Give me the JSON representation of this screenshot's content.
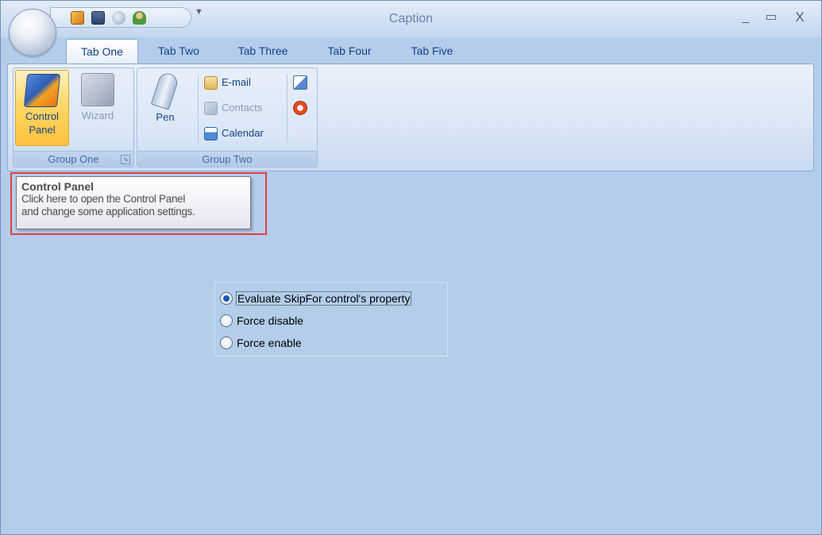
{
  "window": {
    "caption": "Caption"
  },
  "title_buttons": {
    "minimize": "_",
    "maximize": "▭",
    "close": "X"
  },
  "quick_access": {
    "icons": [
      "control-panel-icon",
      "save-icon",
      "search-icon",
      "user-icon"
    ],
    "dropdown": "▼"
  },
  "tabs": [
    {
      "label": "Tab One",
      "active": true
    },
    {
      "label": "Tab Two",
      "active": false
    },
    {
      "label": "Tab Three",
      "active": false
    },
    {
      "label": "Tab Four",
      "active": false
    },
    {
      "label": "Tab Five",
      "active": false
    }
  ],
  "ribbon": {
    "group_one": {
      "title": "Group One",
      "launcher": "↘",
      "control_panel": {
        "line1": "Control",
        "line2": "Panel"
      },
      "wizard": {
        "label": "Wizard"
      }
    },
    "group_two": {
      "title": "Group Two",
      "pen": {
        "label": "Pen"
      },
      "email": {
        "label": "E-mail"
      },
      "contacts": {
        "label": "Contacts"
      },
      "calendar": {
        "label": "Calendar"
      }
    }
  },
  "tooltip": {
    "title": "Control Panel",
    "line1": "Click here to open the Control Panel",
    "line2": "and change some application settings."
  },
  "radio_group": {
    "options": [
      {
        "label": "Evaluate SkipFor control's property",
        "checked": true
      },
      {
        "label": "Force disable",
        "checked": false
      },
      {
        "label": "Force enable",
        "checked": false
      }
    ]
  },
  "colors": {
    "client_background": "#b3cdeb",
    "highlight_border": "#e3403a",
    "tab_text": "#15428b",
    "active_button": "#ffd867"
  }
}
